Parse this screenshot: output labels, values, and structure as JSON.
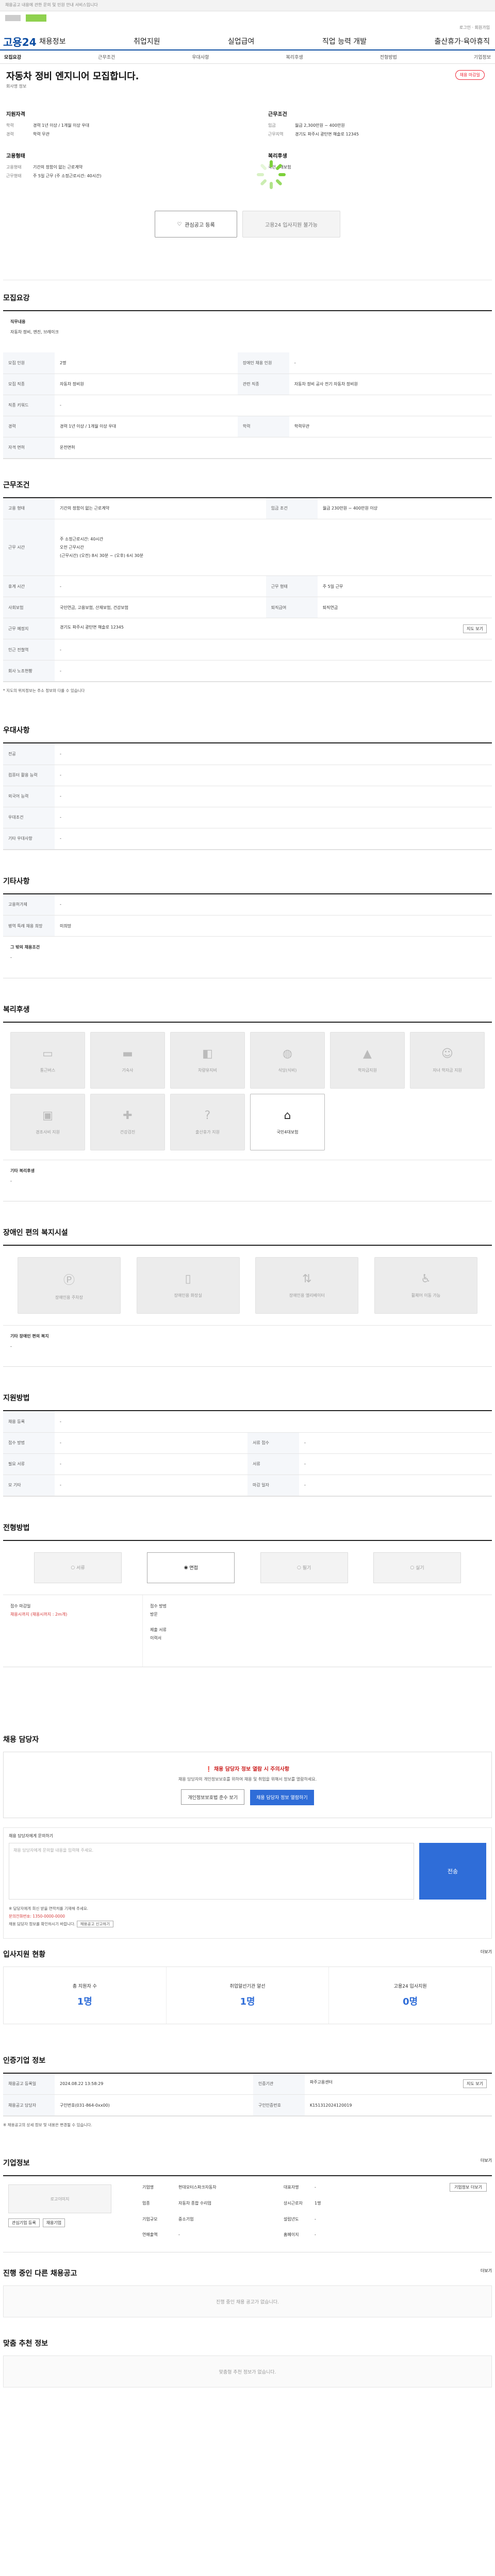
{
  "top_notice": "채용공고 내용에 관한 문의 및 민원 안내 서비스입니다",
  "gnb": {
    "logo": "고용24",
    "menu": [
      "채용정보",
      "취업지원",
      "실업급여",
      "직업 능력 개발",
      "출산휴가·육아휴직"
    ]
  },
  "tabs": [
    "모집요강",
    "근무조건",
    "우대사항",
    "복리후생",
    "전형방법",
    "기업정보"
  ],
  "job": {
    "title": "자동차 정비 엔지니어 모집합니다.",
    "badge": "채용 마감일",
    "company": "회사명 정보",
    "left_group1": "지원자격",
    "edu_k": "학력",
    "edu_v": "경력 1년 이상 / 1개월 이상 우대",
    "career_k": "경력",
    "career_v": "학력 무관",
    "left_group2": "고용형태",
    "emp_k": "고용형태",
    "emp_v": "기간의 정함이 없는 근로계약",
    "hours_k": "근무형태",
    "hours_v": "주 5일 근무 (주 소정근로시간: 40시간)",
    "right_group1": "근무조건",
    "wage_k": "임금",
    "wage_v": "월급 2,300만원 ~ 400만원",
    "loc_k": "근무지역",
    "loc_v": "경기도 파주시 광탄면 해솔로 12345",
    "right_group2": "복리후생",
    "welfare_v": "국민 4대보험",
    "btn_save": "관심공고 등록",
    "btn_apply": "고용24 입사지원 불가능"
  },
  "recruit": {
    "title": "모집요강",
    "duty_title": "직무내용",
    "duty_v": "자동차 정비, 엔진, 브레이크",
    "r1k": "모집 인원",
    "r1v": "2명",
    "r1k2": "장애인 채용 인원",
    "r1v2": "-",
    "r2k": "모집 직종",
    "r2v": "자동차 정비원",
    "r2k2": "관련 직종",
    "r2v2": "자동차 정비 공사 전기 자동차 정비원",
    "r3k": "직종 키워드",
    "r3v": "-",
    "r4k": "경력",
    "r4v": "경력 1년 이상 / 1개월 이상 우대",
    "r4k2": "학력",
    "r4v2": "학력무관",
    "r5k": "자격 면허",
    "r5v": "운전면허"
  },
  "cond": {
    "title": "근무조건",
    "c1k": "고용 형태",
    "c1v": "기간의 정함이 없는 근로계약",
    "c1k2": "임금 조건",
    "c1v2": "월급 230만원 ~ 400만원 이상",
    "c2k": "근무 시간",
    "c2v1": "주 소정근로시간: 40시간",
    "c2v2": "오전 근무시간",
    "c2v3": "(근무시간) (오전) 8시 30분 ~ (오후) 6시 30분",
    "c3k": "휴게 시간",
    "c3v": "-",
    "c3k2": "근무 형태",
    "c3v2": "주 5일 근무",
    "c4k": "사회보험",
    "c4v": "국민연금, 고용보험, 산재보험, 건강보험",
    "c4k2": "퇴직급여",
    "c4v2": "퇴직연금",
    "c5k": "근무 예정지",
    "c5v": "경기도 파주시 광탄면 해솔로 12345",
    "c5btn": "지도 보기",
    "c6k": "인근 전철역",
    "c6v": "-",
    "c7k": "회사 노조현황",
    "c7v": "-",
    "note": "* 지도의 위치정보는 주소 정보와 다를 수 있습니다"
  },
  "pref": {
    "title": "우대사항",
    "p1k": "전공",
    "p1v": "-",
    "p2k": "컴퓨터 활용 능력",
    "p2v": "-",
    "p3k": "외국어 능력",
    "p3v": "-",
    "p4k": "우대조건",
    "p4v": "-",
    "p5k": "기타 우대사항",
    "p5v": "-"
  },
  "other": {
    "title": "기타사항",
    "o1k": "고용허가제",
    "o1v": "-",
    "o2k": "병역 특례 채용 희망",
    "o2v": "미희망",
    "desc": "그 밖의 채용조건",
    "descv": "-"
  },
  "welfare": {
    "title": "복리후생",
    "tiles": [
      "통근버스",
      "기숙사",
      "차량유지비",
      "식당(식비)",
      "학자금지원",
      "자녀 학자금 지원",
      "경조사비 지원",
      "건강검진",
      "출산휴가 지원",
      "국민4대보험"
    ],
    "other_title": "기타 복리후생",
    "other_v": "-"
  },
  "dis": {
    "title": "장애인 편의 복지시설",
    "tiles": [
      "장애인용 주차장",
      "장애인용 화장실",
      "장애인용 엘리베이터",
      "휠체어 이동 가능"
    ],
    "other_title": "기타 장애인 편의 복지",
    "other_v": "-"
  },
  "apply": {
    "title": "지원방법",
    "a1k": "채용 등록",
    "a1v": "-",
    "a2k": "접수 방법",
    "a2v": "-",
    "a2k2": "서류 접수",
    "a2v2": "-",
    "a3k": "필요 서류",
    "a3v": "-",
    "a3k2": "서류",
    "a3v2": "-",
    "a4k": "모 기타",
    "a4v": "-",
    "a4k2": "마감 일자",
    "a4v2": "-"
  },
  "process": {
    "title": "전형방법",
    "steps": [
      "서류",
      "면접",
      "필기",
      "실기"
    ],
    "l1": "접수 마감일",
    "l1v": "채용시까지 (채용시까지 : 2m개)",
    "l2": "접수 방법",
    "l2v": "방문",
    "l3": "제출 서류",
    "l3v": "이력서"
  },
  "hire": {
    "title": "채용 담당자",
    "warn": "채용 담당자 정보 열람 시 주의사항",
    "msg": "채용 담당자의 개인정보보호를 위하여 채용 및 취업을 위해서 정보를 열람하세요.",
    "btn1": "개인정보보호법 준수 보기",
    "btn2": "채용 담당자 정보 열람하기",
    "q_title": "채용 담당자에게 문의하기",
    "q_ph": "채용 담당자에게 문의할 내용을 입력해 주세요.",
    "q_send": "전송",
    "note1": "※ 담당자에게 회신 받을 연락처를 기재해 주세요.",
    "note2": "문의전화번호: 1350-0000-0000",
    "note3": "채용 담당자 정보를 확인하시기 바랍니다.",
    "note_btn": "채용공고 신고하기"
  },
  "stats": {
    "title": "입사지원 현황",
    "more": "더보기",
    "s1": "총 지원자 수",
    "s1v": "1명",
    "s2": "취업알선기관 알선",
    "s2v": "1명",
    "s3": "고용24 입사지원",
    "s3v": "0명"
  },
  "reg": {
    "title": "인증기업 정보",
    "r1k": "채용공고 등록일",
    "r1v": "2024.08.22 13:58:29",
    "r1k2": "인증기관",
    "r1v2": "파주고용센터",
    "r1btn": "지도 보기",
    "r2k": "채용공고 담당자",
    "r2v": "구인번호(031-864-0xx00)",
    "r2k2": "구인인증번호",
    "r2v2": "K151312024120019",
    "note": "※ 채용공고의 상세 정보 및 내용은 변경될 수 있습니다."
  },
  "comp": {
    "title": "기업정보",
    "more": "더보기",
    "logo": "로고이미지",
    "c1k": "기업명",
    "c1v": "현대모터스파크자동차",
    "c2k": "대표자명",
    "c2v": "-",
    "c3k": "업종",
    "c3v": "자동차 종합 수리업",
    "c4k": "상시근로자",
    "c4v": "1명",
    "c5k": "기업규모",
    "c5v": "중소기업",
    "c6k": "설립년도",
    "c6v": "-",
    "c7k": "연매출액",
    "c7v": "-",
    "c8k": "홈페이지",
    "c8v": "-",
    "btn": "기업정보 더보기",
    "link1": "관심기업 등록",
    "link2": "채용기업"
  },
  "similar": {
    "title": "진행 중인 다른 채용공고",
    "more": "더보기",
    "empty": "진행 중인 채용 공고가 없습니다."
  },
  "recommend": {
    "title": "맞춤 추천 정보",
    "empty": "맞춤형 추천 정보가 없습니다."
  }
}
